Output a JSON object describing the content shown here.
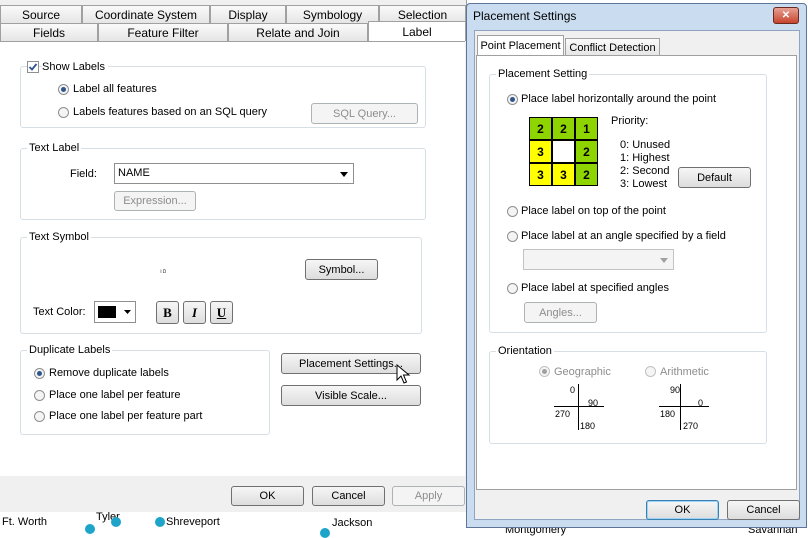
{
  "left_dialog": {
    "tabs_row1": [
      "Source",
      "Coordinate System",
      "Display",
      "Symbology",
      "Selection"
    ],
    "tabs_row2": [
      "Fields",
      "Feature Filter",
      "Relate and Join",
      "Label"
    ],
    "show_labels": {
      "label": "Show Labels",
      "checked": true
    },
    "label_all": "Label all features",
    "label_sql": "Labels features based on an SQL query",
    "sql_button": "SQL Query...",
    "text_label": {
      "title": "Text Label",
      "field_label": "Field:",
      "field_value": "NAME",
      "expression_button": "Expression..."
    },
    "text_symbol": {
      "title": "Text Symbol",
      "preview": "ம",
      "symbol_button": "Symbol...",
      "text_color_label": "Text Color:",
      "text_color": "#000000",
      "bold": "B",
      "italic": "I",
      "underline": "U"
    },
    "duplicate_labels": {
      "title": "Duplicate Labels",
      "options": [
        "Remove duplicate labels",
        "Place one label per feature",
        "Place one label per feature part"
      ]
    },
    "placement_button": "Placement Settings...",
    "visible_scale_button": "Visible Scale...",
    "ok": "OK",
    "cancel": "Cancel",
    "apply": "Apply"
  },
  "right_dialog": {
    "title": "Placement Settings",
    "close": "✕",
    "tabs": [
      "Point Placement",
      "Conflict Detection"
    ],
    "placement_setting_title": "Placement Setting",
    "opt_horizontal": "Place label horizontally around the point",
    "priority_title": "Priority:",
    "priority_legend": [
      "0: Unused",
      "1: Highest",
      "2: Second",
      "3: Lowest"
    ],
    "grid": [
      "2",
      "2",
      "1",
      "3",
      "",
      "2",
      "3",
      "3",
      "2"
    ],
    "default_button": "Default",
    "opt_top": "Place label on top of the point",
    "opt_angle_field": "Place label at an angle specified by a field",
    "opt_specified": "Place label at specified angles",
    "angles_button": "Angles...",
    "orientation_title": "Orientation",
    "geographic": "Geographic",
    "arithmetic": "Arithmetic",
    "geo_ticks": [
      "0",
      "90",
      "270",
      "180"
    ],
    "arith_ticks": [
      "90",
      "0",
      "180",
      "270"
    ],
    "ok": "OK",
    "cancel": "Cancel"
  },
  "map_labels": [
    "Ft. Worth",
    "Tyler",
    "Shreveport",
    "Jackson",
    "Montgomery",
    "Savannah"
  ],
  "colors": {
    "grid_green": "#8ed400",
    "grid_yellow": "#ffff00",
    "accent": "#31548c"
  }
}
